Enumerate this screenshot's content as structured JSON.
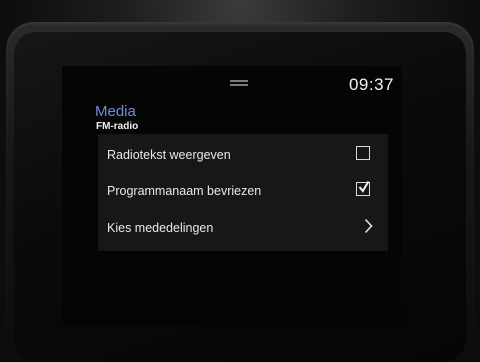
{
  "status_bar": {
    "time": "09:37"
  },
  "header": {
    "title": "Media",
    "subtitle": "FM-radio"
  },
  "settings": {
    "items": [
      {
        "label": "Radiotekst weergeven",
        "control": "checkbox",
        "checked": false
      },
      {
        "label": "Programmanaam bevriezen",
        "control": "checkbox",
        "checked": true
      },
      {
        "label": "Kies mededelingen",
        "control": "chevron"
      }
    ]
  },
  "colors": {
    "accent": "#6e8fd8",
    "text": "#e8e8e8",
    "list_background": "#161718",
    "screen_background": "#050505"
  },
  "icons": {
    "top_handle": "drag-handle-icon",
    "checkbox_empty": "checkbox-unchecked-icon",
    "checkbox_checked": "checkbox-checked-icon",
    "submenu": "chevron-right-icon"
  }
}
